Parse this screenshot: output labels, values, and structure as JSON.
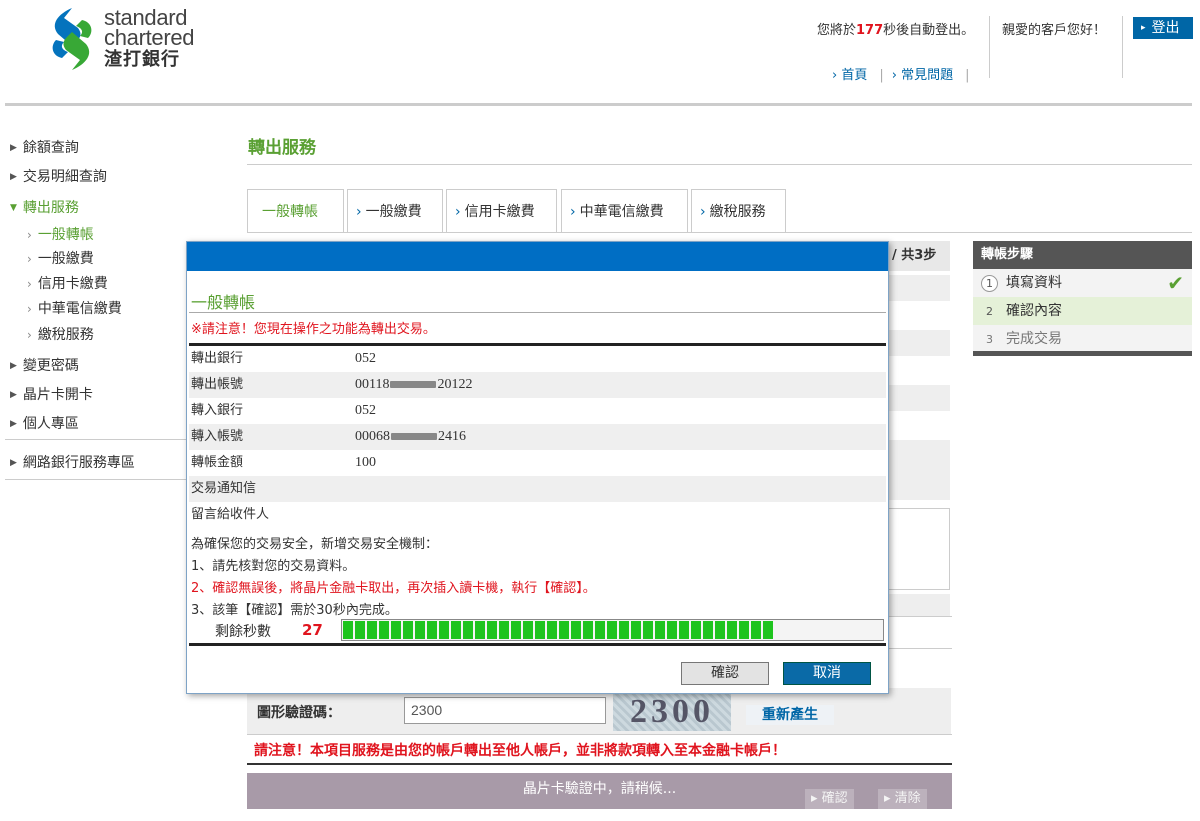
{
  "header": {
    "logo_en_1": "standard",
    "logo_en_2": "chartered",
    "logo_zh": "渣打銀行",
    "logout_msg_prefix": "您將於",
    "logout_seconds": "177",
    "logout_msg_suffix": "秒後自動登出。",
    "greeting": "親愛的客戶您好！",
    "logout_button": "登出",
    "links": [
      "首頁",
      "常見問題"
    ]
  },
  "sidebar": {
    "items": [
      {
        "label": "餘額查詢"
      },
      {
        "label": "交易明細查詢"
      },
      {
        "label": "轉出服務"
      },
      {
        "label": "變更密碼"
      },
      {
        "label": "晶片卡開卡"
      },
      {
        "label": "個人專區"
      },
      {
        "label": "網路銀行服務專區"
      }
    ],
    "subitems": [
      {
        "label": "一般轉帳"
      },
      {
        "label": "一般繳費"
      },
      {
        "label": "信用卡繳費"
      },
      {
        "label": "中華電信繳費"
      },
      {
        "label": "繳稅服務"
      }
    ]
  },
  "main": {
    "title": "轉出服務",
    "tabs": [
      "一般轉帳",
      "一般繳費",
      "信用卡繳費",
      "中華電信繳費",
      "繳稅服務"
    ],
    "behind_step_label": "/ 共3步",
    "captcha_label": "圖形驗證碼：",
    "captcha_value": "2300",
    "captcha_image_text": "2300",
    "regen_button": "重新產生",
    "notice": "請注意！本項目服務是由您的帳戶轉出至他人帳戶，並非將款項轉入至本金融卡帳戶！",
    "wait_text": "晶片卡驗證中，請稍候...",
    "confirm_button": "確認",
    "clear_button": "清除"
  },
  "steps": {
    "title": "轉帳步驟",
    "items": [
      {
        "num": "1",
        "label": "填寫資料"
      },
      {
        "num": "2",
        "label": "確認內容"
      },
      {
        "num": "3",
        "label": "完成交易"
      }
    ]
  },
  "modal": {
    "title": "一般轉帳",
    "warning": "※請注意！您現在操作之功能為轉出交易。",
    "rows": [
      {
        "label": "轉出銀行",
        "value": "052"
      },
      {
        "label": "轉出帳號",
        "value_prefix": "00118",
        "value_suffix": "20122"
      },
      {
        "label": "轉入銀行",
        "value": "052"
      },
      {
        "label": "轉入帳號",
        "value_prefix": "00068",
        "value_suffix": "2416"
      },
      {
        "label": "轉帳金額",
        "value": "100"
      },
      {
        "label": "交易通知信",
        "value": ""
      },
      {
        "label": "留言給收件人",
        "value": ""
      }
    ],
    "security_intro": "為確保您的交易安全，新增交易安全機制：",
    "security_1": "1、請先核對您的交易資料。",
    "security_2": "2、確認無誤後，將晶片金融卡取出，再次插入讀卡機，執行【確認】。",
    "security_3": "3、該筆【確認】需於30秒內完成。",
    "countdown_label": "剩餘秒數",
    "countdown_value": "27",
    "countdown_progress_fraction": 0.9,
    "ok_button": "確認",
    "cancel_button": "取消"
  },
  "colors": {
    "brand_blue": "#0066a6",
    "brand_green": "#5aa033",
    "alert_red": "#e0141e",
    "modal_titlebar": "#006ec4"
  }
}
